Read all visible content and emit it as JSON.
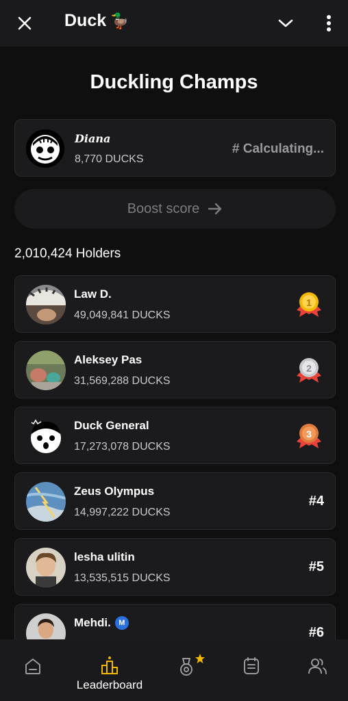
{
  "header": {
    "app_title": "Duck",
    "duck_emoji": "🦆"
  },
  "page": {
    "title": "Duckling Champs"
  },
  "me": {
    "name": "Diana",
    "ducks": "8,770 DUCKS",
    "rank": "# Calculating..."
  },
  "boost": {
    "label": "Boost score"
  },
  "holders": "2,010,424 Holders",
  "leaderboard": [
    {
      "name": "Law D.",
      "ducks": "49,049,841 DUCKS",
      "rank": "1",
      "medal": "gold"
    },
    {
      "name": "Aleksey Pas",
      "ducks": "31,569,288 DUCKS",
      "rank": "2",
      "medal": "silver"
    },
    {
      "name": "Duck General",
      "ducks": "17,273,078 DUCKS",
      "rank": "3",
      "medal": "bronze"
    },
    {
      "name": "Zeus Olympus",
      "ducks": "14,997,222 DUCKS",
      "rank": "#4"
    },
    {
      "name": "lesha ulitin",
      "ducks": "13,535,515 DUCKS",
      "rank": "#5"
    },
    {
      "name": "Mehdi.",
      "ducks": "",
      "rank": "#6",
      "badge": "M"
    }
  ],
  "nav": {
    "active_label": "Leaderboard",
    "items": [
      "home-icon",
      "leaderboard-icon",
      "medal-icon",
      "tasks-icon",
      "friends-icon"
    ]
  },
  "colors": {
    "background": "#0f0f10",
    "card": "#1b1b1d",
    "accent": "#f5b800",
    "gold": "#f5b800",
    "silver": "#c8c8cc",
    "bronze": "#e07a3c",
    "ribbon": "#e8443a"
  }
}
